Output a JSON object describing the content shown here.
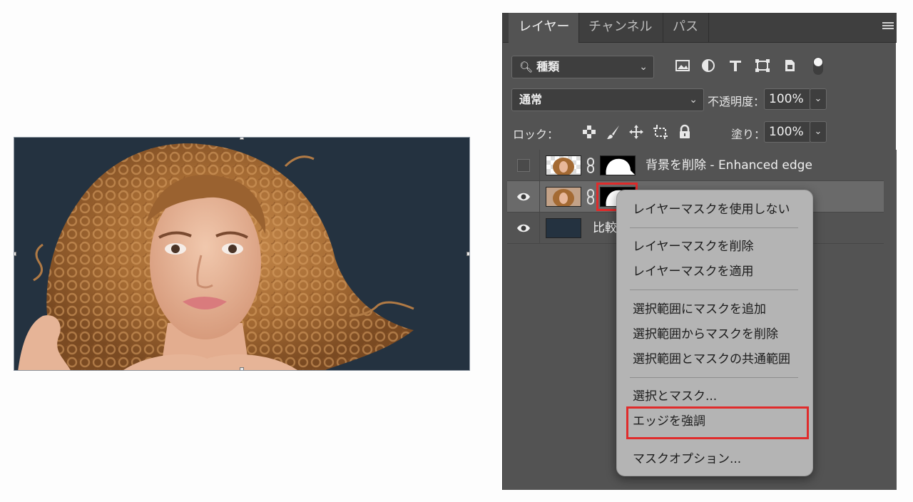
{
  "panel": {
    "tabs": [
      {
        "label": "レイヤー",
        "active": true
      },
      {
        "label": "チャンネル",
        "active": false
      },
      {
        "label": "パス",
        "active": false
      }
    ],
    "filter_select": "種類",
    "filter_icons": [
      "image-filter-icon",
      "adjustment-filter-icon",
      "type-filter-icon",
      "shape-filter-icon",
      "smart-object-filter-icon",
      "filter-toggle-icon"
    ],
    "blend_mode": "通常",
    "opacity_label": "不透明度：",
    "opacity_value": "100%",
    "lock_label": "ロック：",
    "lock_icons": [
      "lock-transparent-pixels-icon",
      "lock-image-pixels-icon",
      "lock-position-icon",
      "lock-artboard-icon",
      "lock-all-icon"
    ],
    "fill_label": "塗り：",
    "fill_value": "100%",
    "layers": [
      {
        "name": "背景を削除 - Enhanced edge",
        "visible": false,
        "selected": false
      },
      {
        "name": "",
        "visible": true,
        "selected": true
      },
      {
        "name": "比較",
        "visible": true,
        "selected": false
      }
    ]
  },
  "context_menu": {
    "items": [
      {
        "label": "レイヤーマスクを使用しない"
      },
      {
        "label": "レイヤーマスクを削除"
      },
      {
        "label": "レイヤーマスクを適用"
      },
      {
        "label": "選択範囲にマスクを追加"
      },
      {
        "label": "選択範囲からマスクを削除"
      },
      {
        "label": "選択範囲とマスクの共通範囲"
      },
      {
        "label": "選択とマスク..."
      },
      {
        "label": "エッジを強調",
        "highlighted": true
      },
      {
        "label": "マスクオプション..."
      }
    ]
  },
  "colors": {
    "canvas_background": "#243240",
    "panel_background": "#535353",
    "highlight_border": "#e02b2b",
    "menu_background": "#b4b4b4"
  }
}
